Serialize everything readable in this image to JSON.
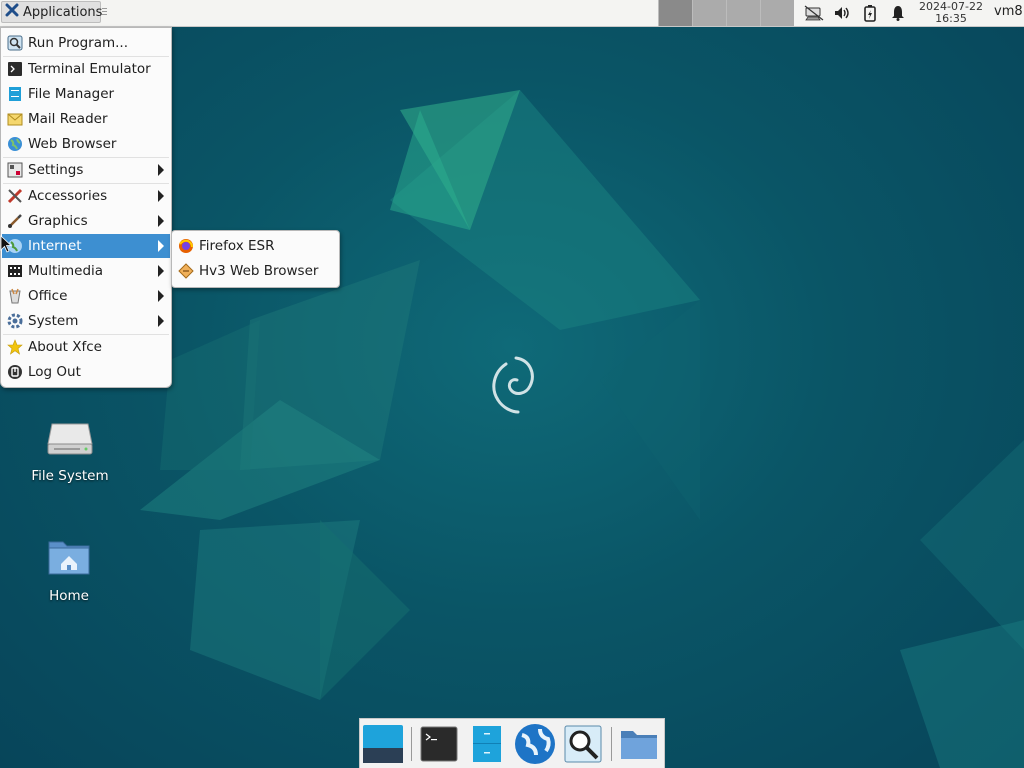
{
  "top_panel": {
    "applications_label": "Applications",
    "clock_date": "2024-07-22",
    "clock_time": "16:35",
    "hostname": "vm8",
    "tray_icons": [
      "network-icon",
      "volume-icon",
      "battery-icon",
      "notifications-bell-icon"
    ]
  },
  "app_menu": {
    "items": [
      {
        "label": "Run Program...",
        "icon": "run-program-icon",
        "submenu": false
      },
      {
        "label": "Terminal Emulator",
        "icon": "terminal-icon",
        "submenu": false
      },
      {
        "label": "File Manager",
        "icon": "file-manager-icon",
        "submenu": false
      },
      {
        "label": "Mail Reader",
        "icon": "mail-icon",
        "submenu": false
      },
      {
        "label": "Web Browser",
        "icon": "web-browser-icon",
        "submenu": false
      },
      {
        "label": "Settings",
        "icon": "settings-icon",
        "submenu": true
      },
      {
        "label": "Accessories",
        "icon": "accessories-icon",
        "submenu": true
      },
      {
        "label": "Graphics",
        "icon": "graphics-icon",
        "submenu": true
      },
      {
        "label": "Internet",
        "icon": "internet-icon",
        "submenu": true,
        "active": true
      },
      {
        "label": "Multimedia",
        "icon": "multimedia-icon",
        "submenu": true
      },
      {
        "label": "Office",
        "icon": "office-icon",
        "submenu": true
      },
      {
        "label": "System",
        "icon": "system-icon",
        "submenu": true
      },
      {
        "label": "About Xfce",
        "icon": "star-icon",
        "submenu": false
      },
      {
        "label": "Log Out",
        "icon": "logout-icon",
        "submenu": false
      }
    ]
  },
  "internet_submenu": {
    "items": [
      {
        "label": "Firefox ESR",
        "icon": "firefox-icon"
      },
      {
        "label": "Hv3 Web Browser",
        "icon": "hv3-browser-icon"
      }
    ]
  },
  "desktop_icons": [
    {
      "label": "File System",
      "icon": "drive-icon"
    },
    {
      "label": "Home",
      "icon": "home-folder-icon"
    }
  ],
  "dock": {
    "items": [
      "show-desktop-icon",
      "terminal-icon",
      "file-manager-icon",
      "web-browser-icon",
      "app-finder-icon",
      "folder-icon"
    ]
  },
  "colors": {
    "menu_highlight": "#3d8fd1",
    "desktop_teal": "#0a5566"
  }
}
